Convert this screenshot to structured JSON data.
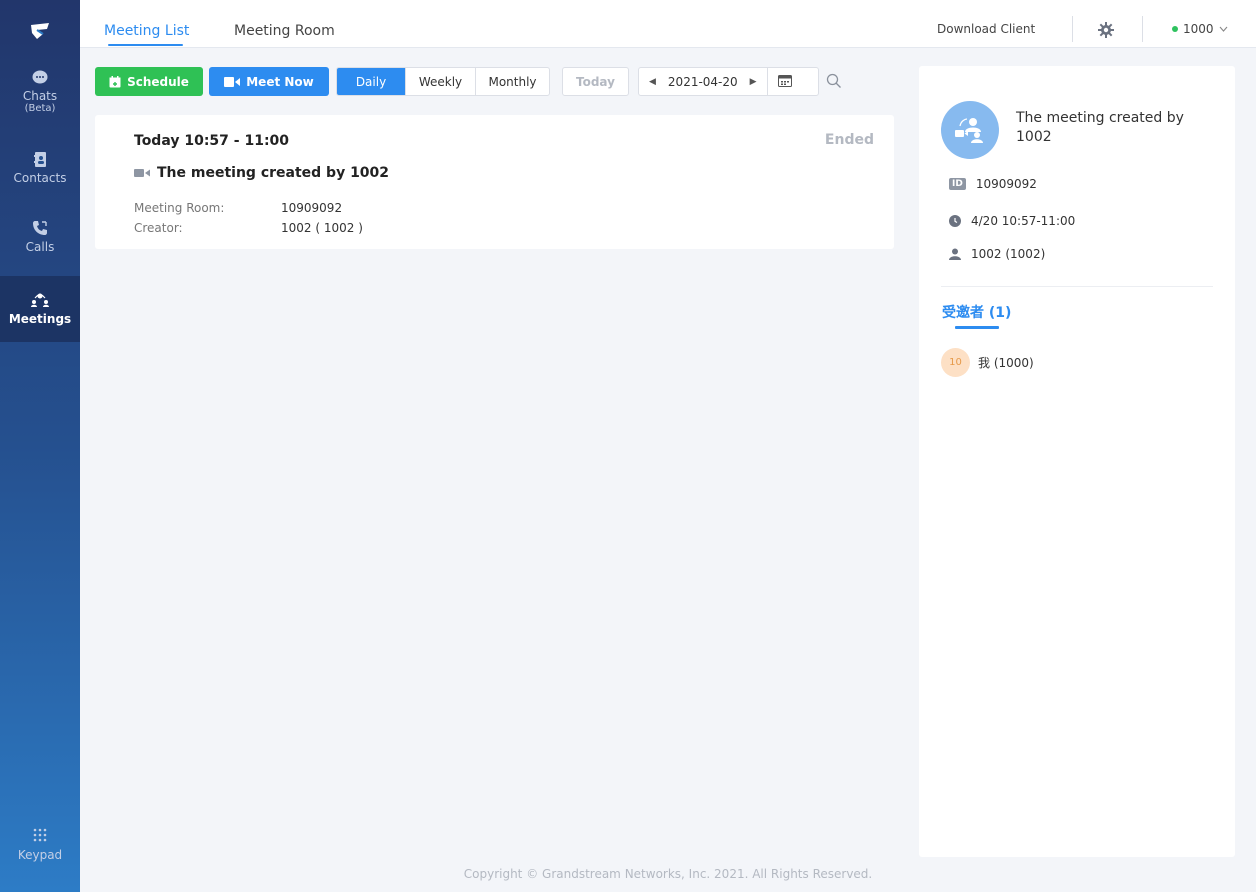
{
  "sidebar": {
    "items": [
      {
        "label": "Chats",
        "sub": "(Beta)"
      },
      {
        "label": "Contacts"
      },
      {
        "label": "Calls"
      },
      {
        "label": "Meetings"
      },
      {
        "label": "Keypad"
      }
    ],
    "active": "Meetings"
  },
  "topbar": {
    "tabs": [
      {
        "label": "Meeting List",
        "active": true
      },
      {
        "label": "Meeting Room",
        "active": false
      }
    ],
    "download_client": "Download Client",
    "user": "1000",
    "user_status_color": "#2ec25f"
  },
  "toolbar": {
    "schedule": "Schedule",
    "meet_now": "Meet Now",
    "views": [
      "Daily",
      "Weekly",
      "Monthly"
    ],
    "active_view": "Daily",
    "today": "Today",
    "date": "2021-04-20"
  },
  "meeting": {
    "time": "Today 10:57 - 11:00",
    "status": "Ended",
    "title": "The meeting created by 1002",
    "room_label": "Meeting Room:",
    "room_value": "10909092",
    "creator_label": "Creator:",
    "creator_value": "1002 ( 1002 )"
  },
  "detail": {
    "title": "The meeting created by 1002",
    "id_badge": "ID",
    "id": "10909092",
    "time": "4/20 10:57-11:00",
    "creator": "1002 (1002)",
    "invitees_tab": "受邀者 (1)",
    "invitees": [
      {
        "avatar": "10",
        "name": "我 (1000)"
      }
    ]
  },
  "footer": {
    "copyright": "Copyright © Grandstream Networks, Inc. 2021. All Rights Reserved."
  },
  "colors": {
    "accent": "#2d8cf0",
    "schedule_green": "#2fc155",
    "sidebar_top": "#22366b",
    "sidebar_bottom": "#2d7cc6"
  }
}
